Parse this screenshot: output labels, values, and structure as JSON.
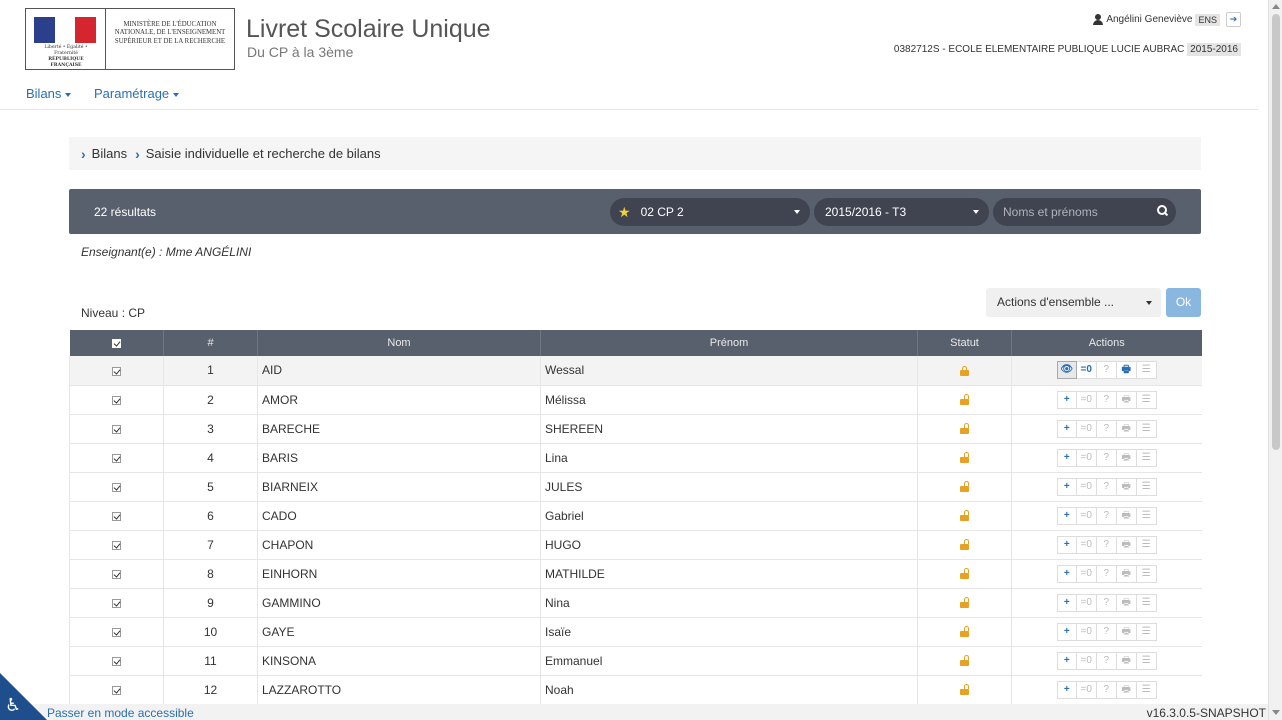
{
  "header": {
    "motto": "Liberté • Égalité • Fraternité",
    "republic": "RÉPUBLIQUE FRANÇAISE",
    "ministry": "MINISTÈRE DE L'ÉDUCATION NATIONALE, DE L'ENSEIGNEMENT SUPÉRIEUR ET DE LA RECHERCHE",
    "title": "Livret Scolaire Unique",
    "subtitle": "Du CP à la 3ème",
    "user_name": "Angélini Geneviève",
    "user_role": "ENS",
    "school": "0382712S - ECOLE ELEMENTAIRE PUBLIQUE LUCIE AUBRAC",
    "school_year": "2015-2016"
  },
  "menu": {
    "bilans": "Bilans",
    "parametrage": "Paramétrage"
  },
  "breadcrumb": {
    "level1": "Bilans",
    "level2": "Saisie individuelle et recherche de bilans"
  },
  "filter": {
    "results": "22 résultats",
    "class_value": "02 CP 2",
    "period_value": "2015/2016 - T3",
    "search_placeholder": "Noms et prénoms"
  },
  "teacher": "Enseignant(e) : Mme ANGÉLINI",
  "level": "Niveau : CP",
  "bulk": {
    "select_label": "Actions d'ensemble ...",
    "ok_label": "Ok"
  },
  "table": {
    "headers": {
      "num": "#",
      "nom": "Nom",
      "prenom": "Prénom",
      "statut": "Statut",
      "actions": "Actions"
    },
    "rows": [
      {
        "num": "1",
        "nom": "AID",
        "prenom": "Wessal",
        "locked": true
      },
      {
        "num": "2",
        "nom": "AMOR",
        "prenom": "Mélissa",
        "locked": false
      },
      {
        "num": "3",
        "nom": "BARECHE",
        "prenom": "SHEREEN",
        "locked": false
      },
      {
        "num": "4",
        "nom": "BARIS",
        "prenom": "Lina",
        "locked": false
      },
      {
        "num": "5",
        "nom": "BIARNEIX",
        "prenom": "JULES",
        "locked": false
      },
      {
        "num": "6",
        "nom": "CADO",
        "prenom": "Gabriel",
        "locked": false
      },
      {
        "num": "7",
        "nom": "CHAPON",
        "prenom": "HUGO",
        "locked": false
      },
      {
        "num": "8",
        "nom": "EINHORN",
        "prenom": "MATHILDE",
        "locked": false
      },
      {
        "num": "9",
        "nom": "GAMMINO",
        "prenom": "Nina",
        "locked": false
      },
      {
        "num": "10",
        "nom": "GAYE",
        "prenom": "Isaïe",
        "locked": false
      },
      {
        "num": "11",
        "nom": "KINSONA",
        "prenom": "Emmanuel",
        "locked": false
      },
      {
        "num": "12",
        "nom": "LAZZAROTTO",
        "prenom": "Noah",
        "locked": false
      }
    ],
    "action_labels": {
      "add": "+",
      "view": "👁",
      "zero": "=0",
      "help": "?",
      "print": "🖶",
      "menu": "☰"
    }
  },
  "footer": {
    "accessible": "Passer en mode accessible",
    "version": "v16.3.0.5-SNAPSHOT"
  },
  "colors": {
    "accent": "#2a6fb3",
    "filter_bar": "#59606d",
    "lock": "#e5a224",
    "ok_button": "#8ab7e0"
  }
}
